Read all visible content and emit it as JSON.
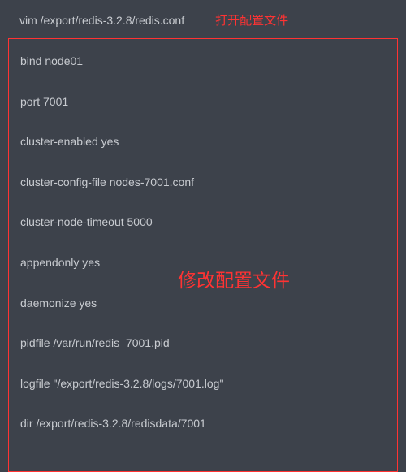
{
  "header": {
    "command": "vim  /export/redis-3.2.8/redis.conf",
    "annotation": "打开配置文件"
  },
  "config": {
    "lines": [
      "bind node01",
      "port 7001",
      "cluster-enabled yes",
      "cluster-config-file nodes-7001.conf",
      "cluster-node-timeout 5000",
      "appendonly yes",
      "daemonize yes",
      "pidfile /var/run/redis_7001.pid",
      "logfile \"/export/redis-3.2.8/logs/7001.log\"",
      "dir /export/redis-3.2.8/redisdata/7001"
    ],
    "annotation": "修改配置文件"
  }
}
